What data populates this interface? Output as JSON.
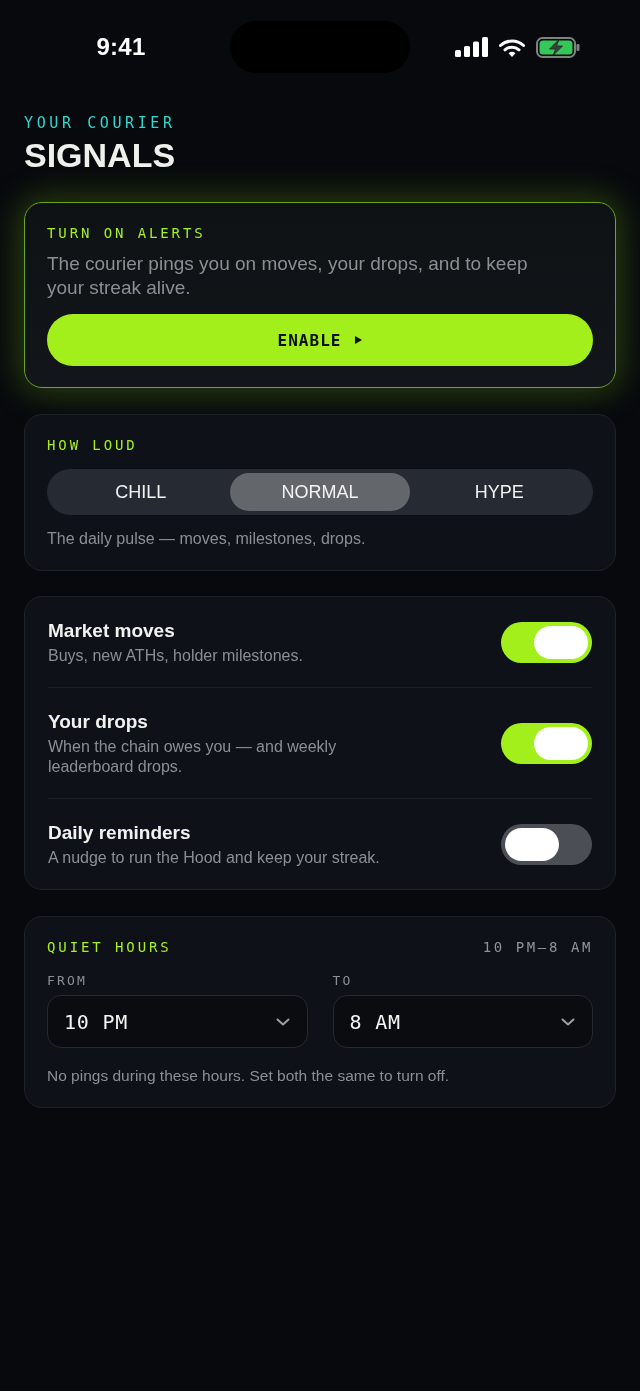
{
  "status_bar": {
    "time": "9:41"
  },
  "header": {
    "eyebrow": "YOUR COURIER",
    "title": "SIGNALS"
  },
  "alerts": {
    "heading": "TURN ON ALERTS",
    "description": "The courier pings you on moves, your drops, and to keep your streak alive.",
    "button": "ENABLE"
  },
  "loudness": {
    "heading": "HOW LOUD",
    "options": [
      {
        "label": "CHILL",
        "selected": false
      },
      {
        "label": "NORMAL",
        "selected": true
      },
      {
        "label": "HYPE",
        "selected": false
      }
    ],
    "description": "The daily pulse — moves, milestones, drops."
  },
  "notifications": {
    "items": [
      {
        "title": "Market moves",
        "description": "Buys, new ATHs, holder milestones.",
        "on": true
      },
      {
        "title": "Your drops",
        "description": "When the chain owes you — and weekly leaderboard drops.",
        "on": true
      },
      {
        "title": "Daily reminders",
        "description": "A nudge to run the Hood and keep your streak.",
        "on": false
      }
    ]
  },
  "quiet_hours": {
    "heading": "QUIET HOURS",
    "summary": "10 PM–8 AM",
    "from": {
      "label": "FROM",
      "value": "10 PM"
    },
    "to": {
      "label": "TO",
      "value": "8 AM"
    },
    "note": "No pings during these hours. Set both the same to turn off."
  }
}
